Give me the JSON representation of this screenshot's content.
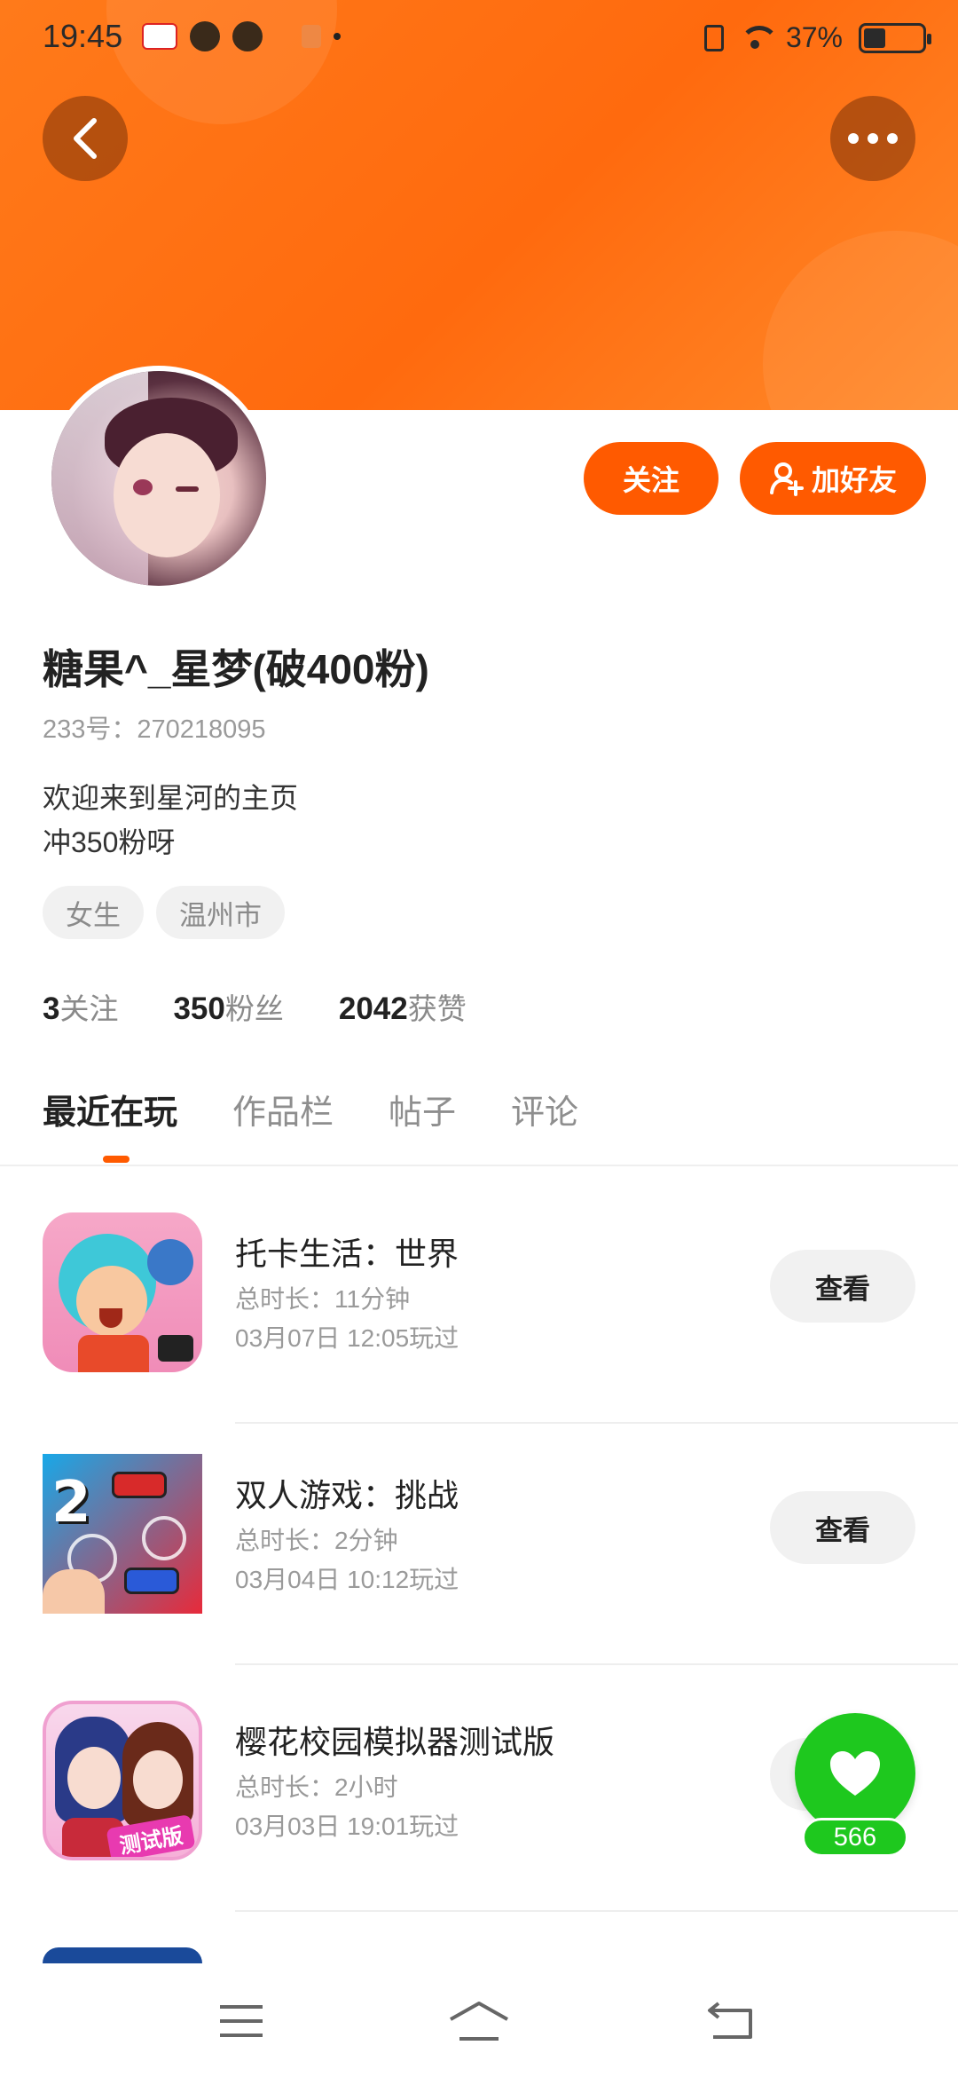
{
  "status_bar": {
    "time": "19:45",
    "battery_percent": "37%",
    "battery_level": 0.37,
    "icons": [
      "app-100-icon",
      "app-circle-icon",
      "app-cat-icon",
      "app-dots-icon",
      "sim-off-icon",
      "wifi-icon",
      "battery-icon"
    ]
  },
  "header": {
    "back_icon": "chevron-left-icon",
    "more_icon": "more-dots-icon"
  },
  "actions": {
    "follow_label": "关注",
    "add_friend_label": "加好友",
    "add_friend_icon": "user-plus-icon"
  },
  "profile": {
    "username": "糖果^_星梦(破400粉)",
    "id_text": "233号：270218095",
    "bio_line1": "欢迎来到星河的主页",
    "bio_line2": "冲350粉呀",
    "tags": [
      "女生",
      "温州市"
    ],
    "stats": [
      {
        "num": "3",
        "label": "关注"
      },
      {
        "num": "350",
        "label": "粉丝"
      },
      {
        "num": "2042",
        "label": "获赞"
      }
    ]
  },
  "tabs": [
    "最近在玩",
    "作品栏",
    "帖子",
    "评论"
  ],
  "active_tab": "最近在玩",
  "games": [
    {
      "title": "托卡生活：世界",
      "duration": "总时长：11分钟",
      "played": "03月07日 12:05玩过",
      "button": "查看"
    },
    {
      "title": "双人游戏：挑战",
      "duration": "总时长：2分钟",
      "played": "03月04日 10:12玩过",
      "button": "查看"
    },
    {
      "title": "樱花校园模拟器测试版",
      "duration": "总时长：2小时",
      "played": "03月03日 19:01玩过",
      "button": "查看"
    }
  ],
  "game_icon_texts": {
    "two_player_number": "2",
    "sakura_badge": "测试版"
  },
  "like": {
    "count": "566",
    "icon": "heart-icon"
  },
  "nav": {
    "menu_icon": "menu-icon",
    "home_icon": "home-icon",
    "back_icon": "back-icon"
  },
  "colors": {
    "accent": "#ff5a00",
    "banner": "#ff7a1a",
    "like_green": "#1ec81e"
  }
}
